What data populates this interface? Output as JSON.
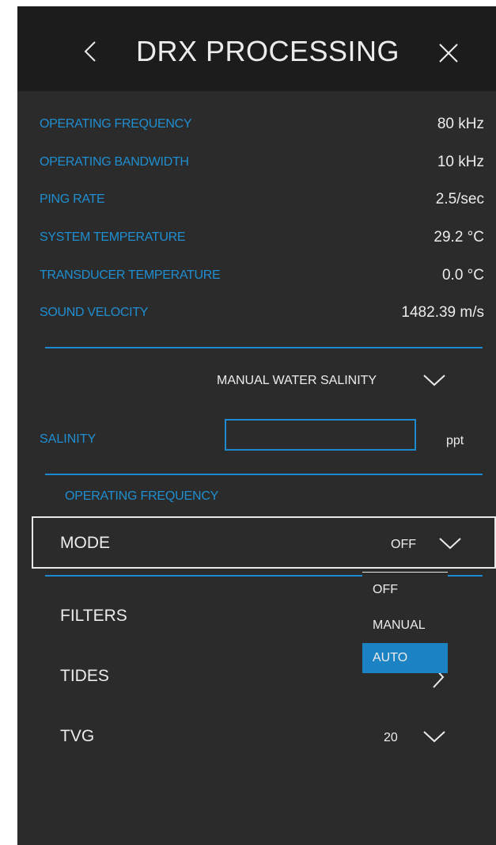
{
  "header": {
    "title": "DRX PROCESSING",
    "back_icon": "chevron-left-icon",
    "close_icon": "close-icon"
  },
  "info": [
    {
      "label": "OPERATING FREQUENCY",
      "value": "80 kHz"
    },
    {
      "label": "OPERATING BANDWIDTH",
      "value": "10 kHz"
    },
    {
      "label": "PING RATE",
      "value": "2.5/sec"
    },
    {
      "label": "SYSTEM TEMPERATURE",
      "value": "29.2 °C"
    },
    {
      "label": "TRANSDUCER TEMPERATURE",
      "value": "0.0 °C"
    },
    {
      "label": "SOUND VELOCITY",
      "value": "1482.39 m/s"
    }
  ],
  "salinity": {
    "mode": "MANUAL WATER SALINITY",
    "label": "SALINITY",
    "value": "",
    "unit": "ppt"
  },
  "operating_frequency": {
    "section_label": "OPERATING FREQUENCY",
    "mode_label": "MODE",
    "mode_value": "OFF",
    "options": [
      "OFF",
      "MANUAL",
      "AUTO"
    ],
    "highlighted": "AUTO"
  },
  "menu": {
    "filters": "FILTERS",
    "tides": "TIDES",
    "tvg": "TVG",
    "tvg_value": "20"
  },
  "colors": {
    "accent": "#1b8ad0",
    "label_blue": "#1f8fd1",
    "panel_bg": "#2b2b2b",
    "header_bg": "#1c1c1c",
    "text": "#ececec",
    "selected_bg": "#1b83c4"
  }
}
